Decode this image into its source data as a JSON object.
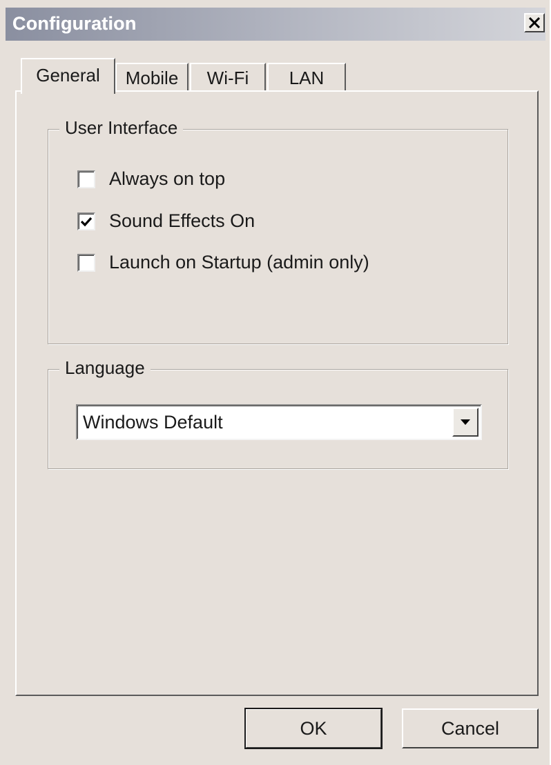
{
  "window": {
    "title": "Configuration"
  },
  "tabs": [
    {
      "label": "General",
      "active": true
    },
    {
      "label": "Mobile",
      "active": false
    },
    {
      "label": "Wi-Fi",
      "active": false
    },
    {
      "label": "LAN",
      "active": false
    }
  ],
  "user_interface": {
    "title": "User Interface",
    "options": [
      {
        "label": "Always on top",
        "checked": false
      },
      {
        "label": "Sound Effects On",
        "checked": true
      },
      {
        "label": "Launch on Startup (admin only)",
        "checked": false
      }
    ]
  },
  "language": {
    "title": "Language",
    "selected": "Windows Default"
  },
  "buttons": {
    "ok": "OK",
    "cancel": "Cancel"
  },
  "icons": {
    "close": "close-icon",
    "dropdown": "chevron-down-icon",
    "check": "checkmark-icon"
  }
}
